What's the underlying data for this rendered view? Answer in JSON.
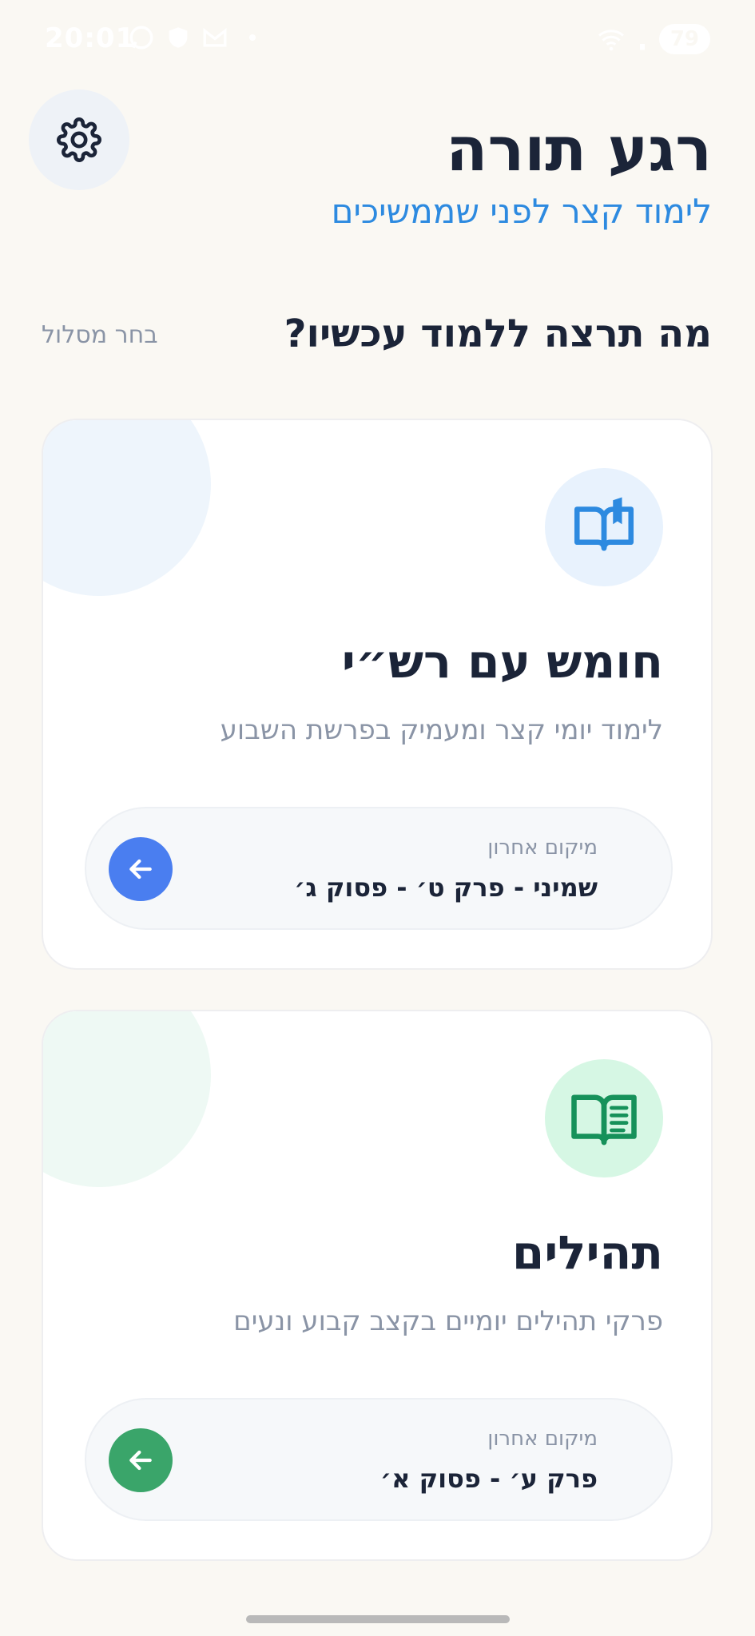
{
  "status_bar": {
    "time": "20:01",
    "battery": "79",
    "icons_left": [
      "whatsapp-icon",
      "shield-icon",
      "gmail-icon"
    ],
    "icons_right": [
      "wifi-icon",
      "signal-icon",
      "battery-icon"
    ]
  },
  "header": {
    "title": "רגע תורה",
    "subtitle": "לימוד קצר לפני שממשיכים",
    "settings_icon": "gear-icon"
  },
  "section": {
    "title": "מה תרצה ללמוד עכשיו?",
    "choose_track": "בחר מסלול"
  },
  "cards": [
    {
      "title": "חומש עם רש״י",
      "description": "לימוד יומי קצר ומעמיק בפרשת השבוע",
      "icon": "book-open-icon",
      "accent": "#2d8ae0",
      "icon_bg": "#e8f2fd",
      "deco_color": "#eef5fc",
      "button_color": "#4a7ef0",
      "progress_label": "מיקום אחרון",
      "progress_value": "שמיני - פרק ט׳ - פסוק ג׳"
    },
    {
      "title": "תהילים",
      "description": "פרקי תהילים יומיים בקצב קבוע ונעים",
      "icon": "book-reader-icon",
      "accent": "#16915a",
      "icon_bg": "#d6f7e4",
      "deco_color": "#eef9f4",
      "button_color": "#3aa56a",
      "progress_label": "מיקום אחרון",
      "progress_value": "פרק ע׳ - פסוק א׳"
    }
  ]
}
